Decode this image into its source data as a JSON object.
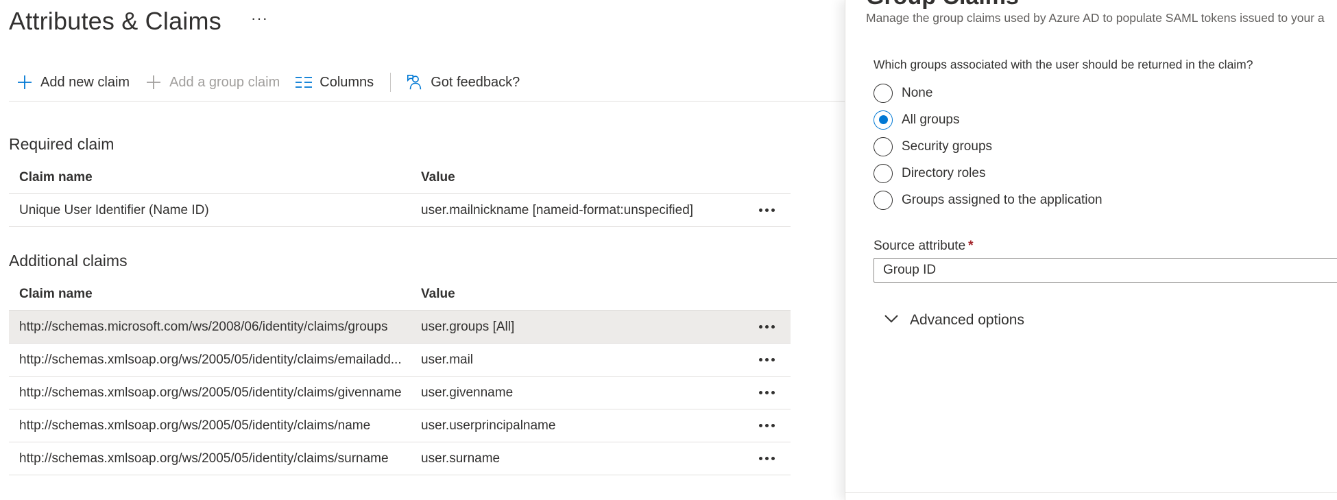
{
  "page": {
    "title": "Attributes & Claims",
    "more_label": "···"
  },
  "toolbar": {
    "add_new_claim": "Add new claim",
    "add_group_claim": "Add a group claim",
    "columns": "Columns",
    "feedback": "Got feedback?"
  },
  "required_claim": {
    "section_title": "Required claim",
    "headers": {
      "name": "Claim name",
      "value": "Value"
    },
    "rows": [
      {
        "name": "Unique User Identifier (Name ID)",
        "value": "user.mailnickname [nameid-format:unspecified]"
      }
    ]
  },
  "additional_claims": {
    "section_title": "Additional claims",
    "headers": {
      "name": "Claim name",
      "value": "Value"
    },
    "rows": [
      {
        "name": "http://schemas.microsoft.com/ws/2008/06/identity/claims/groups",
        "value": "user.groups [All]",
        "selected": true
      },
      {
        "name": "http://schemas.xmlsoap.org/ws/2005/05/identity/claims/emailadd...",
        "value": "user.mail"
      },
      {
        "name": "http://schemas.xmlsoap.org/ws/2005/05/identity/claims/givenname",
        "value": "user.givenname"
      },
      {
        "name": "http://schemas.xmlsoap.org/ws/2005/05/identity/claims/name",
        "value": "user.userprincipalname"
      },
      {
        "name": "http://schemas.xmlsoap.org/ws/2005/05/identity/claims/surname",
        "value": "user.surname"
      }
    ]
  },
  "panel": {
    "title": "Group Claims",
    "description": "Manage the group claims used by Azure AD to populate SAML tokens issued to your a",
    "question": "Which groups associated with the user should be returned in the claim?",
    "options": [
      {
        "label": "None",
        "checked": false
      },
      {
        "label": "All groups",
        "checked": true
      },
      {
        "label": "Security groups",
        "checked": false
      },
      {
        "label": "Directory roles",
        "checked": false
      },
      {
        "label": "Groups assigned to the application",
        "checked": false
      }
    ],
    "source_attribute_label": "Source attribute",
    "required_marker": "*",
    "source_attribute_value": "Group ID",
    "advanced_options": "Advanced options"
  },
  "colors": {
    "accent": "#0078d4",
    "text": "#323130",
    "disabled": "#a19f9d",
    "selected_row": "#edebe9",
    "required": "#a4262c"
  },
  "icons": {
    "add": "plus-icon",
    "columns": "columns-icon",
    "feedback": "feedback-icon",
    "more": "more-dots-icon",
    "chevron": "chevron-down-icon"
  }
}
